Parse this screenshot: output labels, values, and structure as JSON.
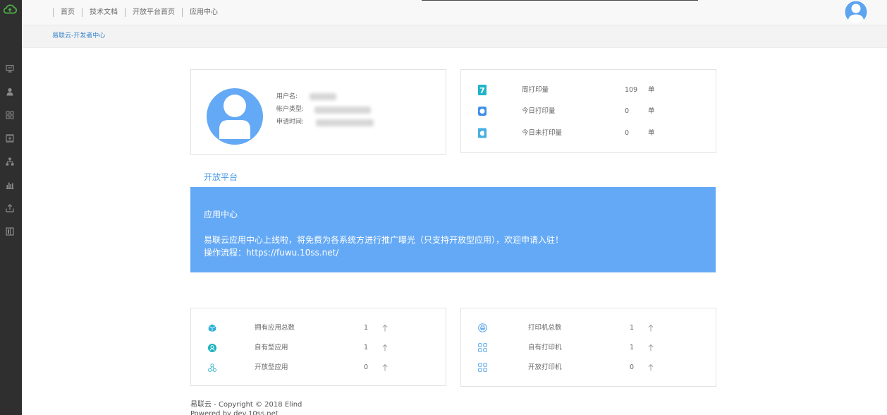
{
  "colors": {
    "sidebar_bg": "#2f2f2f",
    "accent": "#64a9f5",
    "link": "#3b87cc",
    "teal": "#1fb4c8",
    "logo_green": "#4fb146"
  },
  "sidebar": {
    "logo_icon": "cloud-logo-icon",
    "items": [
      {
        "icon": "monitor-icon"
      },
      {
        "icon": "user-icon"
      },
      {
        "icon": "grid-icon"
      },
      {
        "icon": "plus-box-icon"
      },
      {
        "icon": "sitemap-icon"
      },
      {
        "icon": "bar-chart-icon"
      },
      {
        "icon": "upload-icon"
      },
      {
        "icon": "columns-icon"
      }
    ]
  },
  "header": {
    "nav": [
      {
        "label": "首页"
      },
      {
        "label": "技术文档"
      },
      {
        "label": "开放平台首页"
      },
      {
        "label": "应用中心"
      }
    ],
    "avatar_icon": "avatar-icon"
  },
  "breadcrumb": {
    "label": "易联云-开发者中心"
  },
  "profile": {
    "avatar_icon": "avatar-icon",
    "fields": [
      {
        "label": "用户名:"
      },
      {
        "label": "帐户类型:"
      },
      {
        "label": "申请时间:"
      }
    ]
  },
  "print_stats": {
    "rows": [
      {
        "icon": "calendar-week-icon",
        "icon_text": "7",
        "label": "周打印量",
        "value": "109",
        "unit": "单"
      },
      {
        "icon": "today-icon",
        "label": "今日打印量",
        "value": "0",
        "unit": "单"
      },
      {
        "icon": "pending-icon",
        "label": "今日未打印量",
        "value": "0",
        "unit": "单"
      }
    ]
  },
  "open_platform": {
    "section_title": "开放平台",
    "banner": {
      "title": "应用中心",
      "line1": "易联云应用中心上线啦，将免费为各系统方进行推广曝光（只支持开放型应用），欢迎申请入驻！",
      "line2_label": "操作流程：",
      "line2_link": "https://fuwu.10ss.net/"
    }
  },
  "app_stats": {
    "rows": [
      {
        "icon": "cube-icon",
        "label": "拥有应用总数",
        "value": "1",
        "trend_icon": "arrow-up-icon"
      },
      {
        "icon": "user-circle-icon",
        "label": "自有型应用",
        "value": "1",
        "trend_icon": "arrow-up-icon"
      },
      {
        "icon": "share-nodes-icon",
        "label": "开放型应用",
        "value": "0",
        "trend_icon": "arrow-up-icon"
      }
    ]
  },
  "printer_stats": {
    "rows": [
      {
        "icon": "printer-icon",
        "label": "打印机总数",
        "value": "1",
        "trend_icon": "arrow-up-icon"
      },
      {
        "icon": "qr-grid-icon",
        "label": "自有打印机",
        "value": "1",
        "trend_icon": "arrow-up-icon"
      },
      {
        "icon": "qr-grid-icon",
        "label": "开放打印机",
        "value": "0",
        "trend_icon": "arrow-up-icon"
      }
    ]
  },
  "footer": {
    "copyright": "易联云 - Copyright © 2018 Elind",
    "powered": "Powered by dev.10ss.net"
  }
}
